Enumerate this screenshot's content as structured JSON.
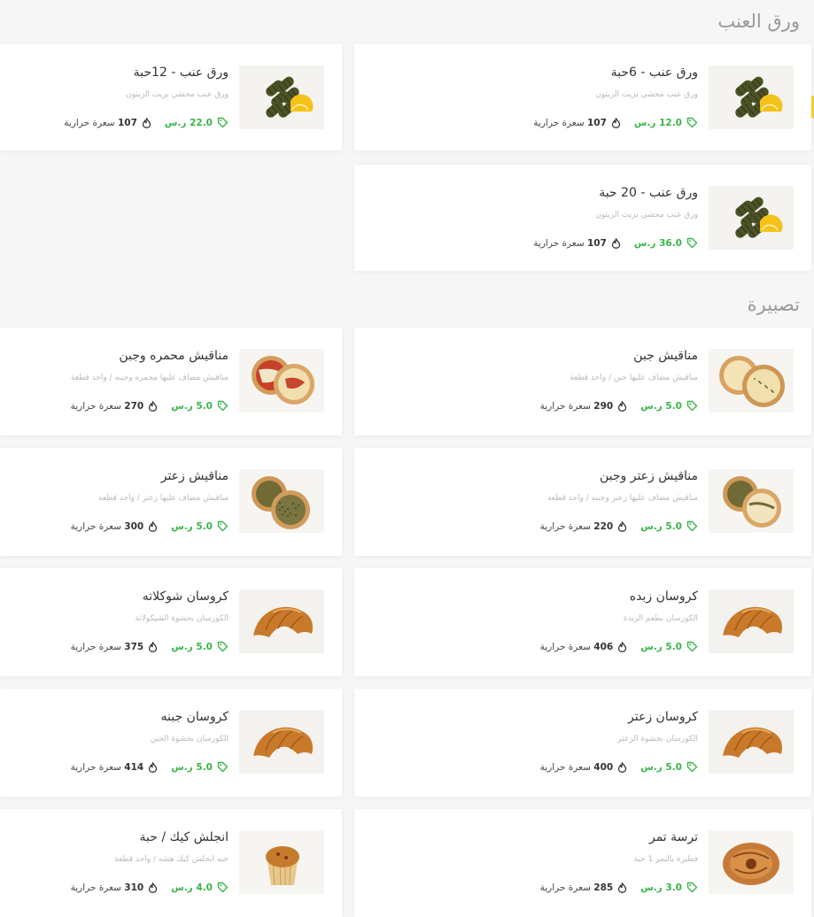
{
  "sections": [
    {
      "title": "ورق العنب"
    },
    {
      "title": "تصبيرة"
    }
  ],
  "currency": "ر.س",
  "calories_unit": "سعرة حرارية",
  "items": [
    {
      "name": "ورق عنب - 6حبة",
      "desc": "ورق عنب محشي بزيت الزيتون",
      "price": "12.0",
      "calories": "107",
      "image": "grape-leaves"
    },
    {
      "name": "ورق عنب - 12حبة",
      "desc": "ورق عنب محشي بزيت الزيتون",
      "price": "22.0",
      "calories": "107",
      "image": "grape-leaves"
    },
    {
      "name": "ورق عنب - 20 حبة",
      "desc": "ورق عنب محشي بزيت الزيتون",
      "price": "36.0",
      "calories": "107",
      "image": "grape-leaves"
    },
    {
      "name": "مناقيش جبن",
      "desc": "مناقيش مضاف عليها جبن / واحد قطعة",
      "price": "5.0",
      "calories": "290",
      "image": "cheese-manakish"
    },
    {
      "name": "مناقيش محمره وجبن",
      "desc": "مناقيش مضاف عليها محمره وجبنه / واحد قطعة",
      "price": "5.0",
      "calories": "270",
      "image": "muhammara-manakish"
    },
    {
      "name": "مناقيش زعتر وجبن",
      "desc": "مناقيش مضاف عليها زعتر وجبنه / واحد قطعة",
      "price": "5.0",
      "calories": "220",
      "image": "zaatar-cheese-manakish"
    },
    {
      "name": "مناقيش زعتر",
      "desc": "مناقيش مضاف عليها زعتر / واحد قطعة",
      "price": "5.0",
      "calories": "300",
      "image": "zaatar-manakish"
    },
    {
      "name": "كروسان زبده",
      "desc": "الكورسان بطعم الزبدة",
      "price": "5.0",
      "calories": "406",
      "image": "croissant"
    },
    {
      "name": "كروسان شوكلاته",
      "desc": "الكورسان بحشوة الشيكولاتة",
      "price": "5.0",
      "calories": "375",
      "image": "croissant"
    },
    {
      "name": "كروسان زعتر",
      "desc": "الكورسان بحشوة الزعتر",
      "price": "5.0",
      "calories": "400",
      "image": "croissant"
    },
    {
      "name": "كروسان جبنه",
      "desc": "الكورسان بحشوة الجبن",
      "price": "5.0",
      "calories": "414",
      "image": "croissant"
    },
    {
      "name": "ترسة تمر",
      "desc": "فطيرة بالتمر 1 حبة",
      "price": "3.0",
      "calories": "285",
      "image": "date-pastry"
    },
    {
      "name": "انجلش كيك / حبة",
      "desc": "حبه انجلش كيك هشه / واحد قطعة",
      "price": "4.0",
      "calories": "310",
      "image": "english-cake"
    }
  ],
  "colors": {
    "accent": "#39b54a",
    "background": "#f6f6f6",
    "card": "#ffffff",
    "side_button": "#f4d12a"
  }
}
